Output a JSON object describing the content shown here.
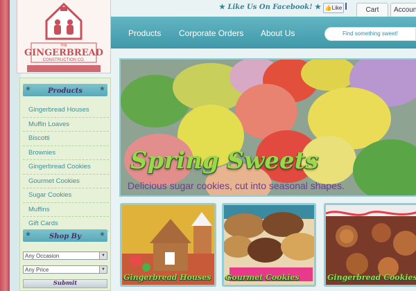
{
  "header": {
    "social_text": "Like Us On Facebook!",
    "like_label": "Like",
    "cart_label": "Cart",
    "account_label": "Account"
  },
  "logo": {
    "line1": "THE",
    "line2": "GINGERBREAD",
    "line3": "CONSTRUCTION CO."
  },
  "nav": {
    "items": [
      {
        "label": "Products"
      },
      {
        "label": "Corporate Orders"
      },
      {
        "label": "About Us"
      }
    ],
    "search_placeholder": "Find something sweet!"
  },
  "sidebar": {
    "products_heading": "Products",
    "products": [
      {
        "label": "Gingerbread Houses"
      },
      {
        "label": "Muffin Loaves"
      },
      {
        "label": "Biscotti"
      },
      {
        "label": "Brownies"
      },
      {
        "label": "Gingerbread Cookies"
      },
      {
        "label": "Gourmet Cookies"
      },
      {
        "label": "Sugar Cookies"
      },
      {
        "label": "Muffins"
      },
      {
        "label": "Gift Cards"
      }
    ],
    "shopby_heading": "Shop By",
    "occasion_value": "Any Occasion",
    "price_value": "Any Price",
    "submit_label": "Submit"
  },
  "hero": {
    "title": "Spring Sweets",
    "subtitle": "Delicious sugar cookies, cut into seasonal shapes."
  },
  "tiles": [
    {
      "label": "Gingerbread Houses"
    },
    {
      "label": "Gourmet Cookies"
    },
    {
      "label": "Gingerbread Cookies"
    }
  ],
  "colors": {
    "accent_teal": "#4aa7b6",
    "brand_red": "#c8505a",
    "title_green": "#9ad84a",
    "link_teal": "#3f8f96",
    "heading_purple": "#4b2c6e"
  }
}
